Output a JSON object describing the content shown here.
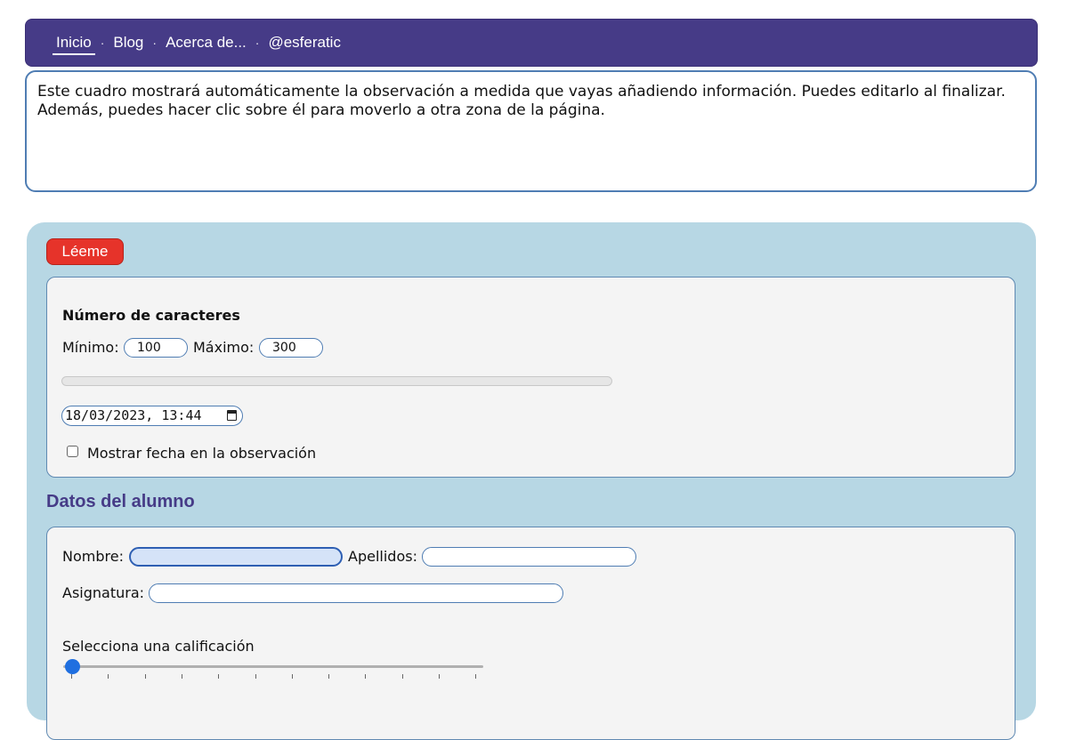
{
  "nav": {
    "items": [
      {
        "label": "Inicio",
        "active": true
      },
      {
        "label": "Blog",
        "active": false
      },
      {
        "label": "Acerca de...",
        "active": false
      },
      {
        "label": "@esferatic",
        "active": false
      }
    ],
    "separator": "·"
  },
  "observation": {
    "text": "Este cuadro mostrará automáticamente la observación a medida que vayas añadiendo información. Puedes editarlo al finalizar. Además, puedes hacer clic sobre él para moverlo a otra zona de la página."
  },
  "readme_button": {
    "label": "Léeme",
    "color": "#e6332a"
  },
  "characters": {
    "heading": "Número de caracteres",
    "min_label": "Mínimo:",
    "min_value": "100",
    "max_label": "Máximo:",
    "max_value": "300",
    "progress_fraction": 0
  },
  "date": {
    "value": "18/03/2023, 13:44",
    "icon": "calendar-icon",
    "show_in_observation_label": "Mostrar fecha en la observación",
    "show_in_observation_checked": false
  },
  "student": {
    "section_title": "Datos del alumno",
    "name_label": "Nombre:",
    "name_value": "",
    "surname_label": "Apellidos:",
    "surname_value": "",
    "subject_label": "Asignatura:",
    "subject_value": "",
    "grade_label": "Selecciona una calificación",
    "grade_value": 0
  },
  "colors": {
    "nav_bg": "#463b87",
    "panel_bg": "#b7d7e4",
    "accent": "#1f6fe0"
  }
}
